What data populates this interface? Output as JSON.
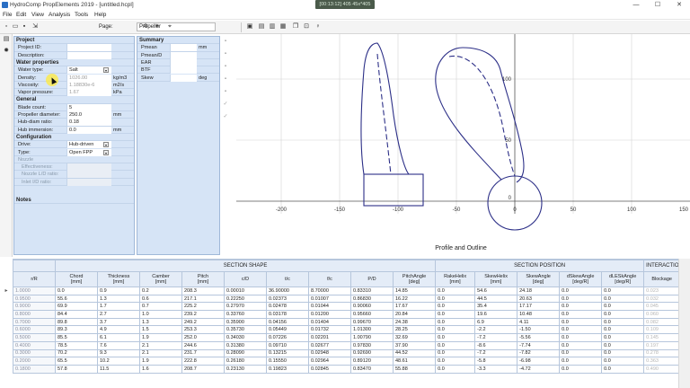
{
  "window": {
    "title": "HydroComp PropElements 2019 - [untitled.hcpl]",
    "recording_label": "[00:13:12] 405 45x*405",
    "minimize": "—",
    "maximize": "☐",
    "close": "✕"
  },
  "menu": [
    "File",
    "Edit",
    "View",
    "Analysis",
    "Tools",
    "Help"
  ],
  "toolbar": {
    "page_label": "Page:",
    "page_value": "Propeller"
  },
  "input_panel": {
    "sections": {
      "project": "Project",
      "water": "Water properties",
      "general": "General",
      "configuration": "Configuration",
      "notes": "Notes"
    },
    "project": [
      {
        "label": "Project ID:",
        "value": ""
      },
      {
        "label": "Description:",
        "value": ""
      }
    ],
    "water": [
      {
        "label": "Water type:",
        "value": "Salt",
        "unit": ""
      },
      {
        "label": "Density:",
        "value": "1026.00",
        "unit": "kg/m3"
      },
      {
        "label": "Viscosity:",
        "value": "1.18830e-6",
        "unit": "m2/s"
      },
      {
        "label": "Vapor pressure:",
        "value": "1.67",
        "unit": "kPa"
      }
    ],
    "general": [
      {
        "label": "Blade count:",
        "value": "5",
        "unit": ""
      },
      {
        "label": "Propeller diameter:",
        "value": "250.0",
        "unit": "mm"
      },
      {
        "label": "Hub-diam ratio:",
        "value": "0.18",
        "unit": ""
      },
      {
        "label": "Hub immersion:",
        "value": "0.0",
        "unit": "mm"
      }
    ],
    "configuration": [
      {
        "label": "Drive:",
        "value": "Hub-driven"
      },
      {
        "label": "Type:",
        "value": "Open FPP"
      },
      {
        "label": "Nozzle",
        "value": ""
      },
      {
        "label": "Effectiveness:",
        "value": ""
      },
      {
        "label": "Nozzle L/D ratio:",
        "value": ""
      },
      {
        "label": "Inlet I/D ratio:",
        "value": ""
      }
    ]
  },
  "summary_panel": {
    "title": "Summary",
    "rows": [
      {
        "label": "Pmean",
        "value": "",
        "unit": "mm"
      },
      {
        "label": "Pmean/D",
        "value": "",
        "unit": ""
      },
      {
        "label": "EAR",
        "value": "",
        "unit": ""
      },
      {
        "label": "BTF",
        "value": "",
        "unit": ""
      },
      {
        "label": "Skew",
        "value": "",
        "unit": "deg"
      }
    ]
  },
  "drawing": {
    "caption": "Profile and Outline",
    "x_ticks": [
      "-200",
      "-150",
      "-100",
      "-50",
      "0",
      "50",
      "100",
      "150"
    ],
    "y_ticks": [
      "100",
      "50",
      "0"
    ]
  },
  "table": {
    "groups": [
      "SECTION SHAPE",
      "SECTION POSITION",
      "INTERACTION"
    ],
    "headers": [
      {
        "name": "r/R",
        "unit": ""
      },
      {
        "name": "Chord",
        "unit": "[mm]"
      },
      {
        "name": "Thickness",
        "unit": "[mm]"
      },
      {
        "name": "Camber",
        "unit": "[mm]"
      },
      {
        "name": "Pitch",
        "unit": "[mm]"
      },
      {
        "name": "c/D",
        "unit": ""
      },
      {
        "name": "t/c",
        "unit": ""
      },
      {
        "name": "f/c",
        "unit": ""
      },
      {
        "name": "P/D",
        "unit": ""
      },
      {
        "name": "PitchAngle",
        "unit": "[deg]"
      },
      {
        "name": "RakeHelix",
        "unit": "[mm]"
      },
      {
        "name": "SkewHelix",
        "unit": "[mm]"
      },
      {
        "name": "SkewAngle",
        "unit": "[deg]"
      },
      {
        "name": "dSkewAngle",
        "unit": "[deg/R]"
      },
      {
        "name": "dLESkAngle",
        "unit": "[deg/R]"
      },
      {
        "name": "Blockage",
        "unit": ""
      }
    ],
    "rows": [
      [
        "1.0000",
        "0.0",
        "0.9",
        "0.2",
        "208.3",
        "0.00010",
        "36.90000",
        "8.70000",
        "0.83310",
        "14.85",
        "0.0",
        "54.6",
        "24.18",
        "0.0",
        "0.0",
        "0.023"
      ],
      [
        "0.9500",
        "55.6",
        "1.3",
        "0.6",
        "217.1",
        "0.22250",
        "0.02373",
        "0.01007",
        "0.86830",
        "16.22",
        "0.0",
        "44.5",
        "20.63",
        "0.0",
        "0.0",
        "0.032"
      ],
      [
        "0.9000",
        "69.9",
        "1.7",
        "0.7",
        "225.2",
        "0.27970",
        "0.02478",
        "0.01044",
        "0.90060",
        "17.67",
        "0.0",
        "35.4",
        "17.17",
        "0.0",
        "0.0",
        "0.045"
      ],
      [
        "0.8000",
        "84.4",
        "2.7",
        "1.0",
        "239.2",
        "0.33760",
        "0.03178",
        "0.01200",
        "0.95660",
        "20.84",
        "0.0",
        "19.6",
        "10.48",
        "0.0",
        "0.0",
        "0.060"
      ],
      [
        "0.7000",
        "89.8",
        "3.7",
        "1.3",
        "249.2",
        "0.35900",
        "0.04156",
        "0.01404",
        "0.99670",
        "24.38",
        "0.0",
        "6.9",
        "4.11",
        "0.0",
        "0.0",
        "0.082"
      ],
      [
        "0.6000",
        "89.3",
        "4.9",
        "1.5",
        "253.3",
        "0.35730",
        "0.05449",
        "0.01732",
        "1.01300",
        "28.25",
        "0.0",
        "-2.2",
        "-1.50",
        "0.0",
        "0.0",
        "0.109"
      ],
      [
        "0.5000",
        "85.5",
        "6.1",
        "1.9",
        "252.0",
        "0.34030",
        "0.07226",
        "0.02201",
        "1.00790",
        "32.69",
        "0.0",
        "-7.2",
        "-5.56",
        "0.0",
        "0.0",
        "0.145"
      ],
      [
        "0.4000",
        "78.5",
        "7.6",
        "2.1",
        "244.6",
        "0.31380",
        "0.09710",
        "0.02677",
        "0.97830",
        "37.90",
        "0.0",
        "-8.6",
        "-7.74",
        "0.0",
        "0.0",
        "0.197"
      ],
      [
        "0.3000",
        "70.2",
        "9.3",
        "2.1",
        "231.7",
        "0.28090",
        "0.13215",
        "0.02948",
        "0.92690",
        "44.52",
        "0.0",
        "-7.2",
        "-7.82",
        "0.0",
        "0.0",
        "0.278"
      ],
      [
        "0.2000",
        "65.5",
        "10.2",
        "1.9",
        "222.8",
        "0.26180",
        "0.15550",
        "0.02964",
        "0.89120",
        "48.61",
        "0.0",
        "-5.8",
        "-6.98",
        "0.0",
        "0.0",
        "0.363"
      ],
      [
        "0.1800",
        "57.8",
        "11.5",
        "1.6",
        "208.7",
        "0.23130",
        "0.19823",
        "0.02845",
        "0.83470",
        "55.88",
        "0.0",
        "-3.3",
        "-4.72",
        "0.0",
        "0.0",
        "0.490"
      ]
    ]
  },
  "colors": {
    "panel_bg": "#d6e4f6",
    "blade_outline": "#2c2f87",
    "grid_line": "#cfcfcf",
    "highlight": "#ffeb3b"
  }
}
